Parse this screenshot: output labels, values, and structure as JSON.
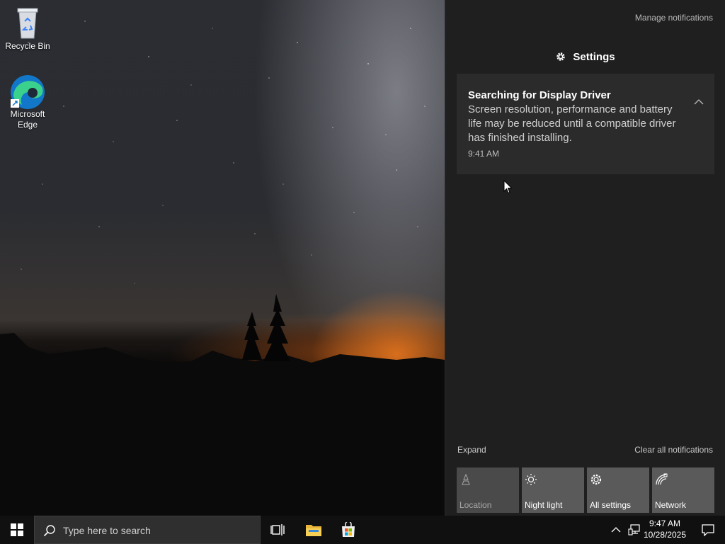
{
  "desktop": {
    "icons": [
      {
        "label": "Recycle Bin",
        "icon": "recycle-bin-icon"
      },
      {
        "label": "Microsoft Edge",
        "icon": "edge-icon"
      }
    ]
  },
  "action_center": {
    "manage_notifications": "Manage notifications",
    "settings_header": "Settings",
    "notification": {
      "title": "Searching for Display Driver",
      "body": "Screen resolution, performance and battery life may be reduced until a compatible driver has finished installing.",
      "time": "9:41 AM"
    },
    "expand": "Expand",
    "clear_all": "Clear all notifications",
    "quick_actions": [
      {
        "label": "Location",
        "icon": "location-icon",
        "enabled": false
      },
      {
        "label": "Night light",
        "icon": "night-light-icon",
        "enabled": true
      },
      {
        "label": "All settings",
        "icon": "gear-icon",
        "enabled": true
      },
      {
        "label": "Network",
        "icon": "network-icon",
        "enabled": true
      }
    ]
  },
  "taskbar": {
    "search_placeholder": "Type here to search",
    "pinned": [
      "task-view-icon",
      "file-explorer-icon",
      "microsoft-store-icon"
    ],
    "clock_time": "9:47 AM",
    "clock_date": "10/28/2025"
  },
  "colors": {
    "action_center_bg": "#1f1f1f",
    "notification_bg": "#2b2b2b",
    "tile_bg": "#5a5a5a",
    "taskbar_bg": "#101010",
    "accent_orange": "#eb781e"
  }
}
